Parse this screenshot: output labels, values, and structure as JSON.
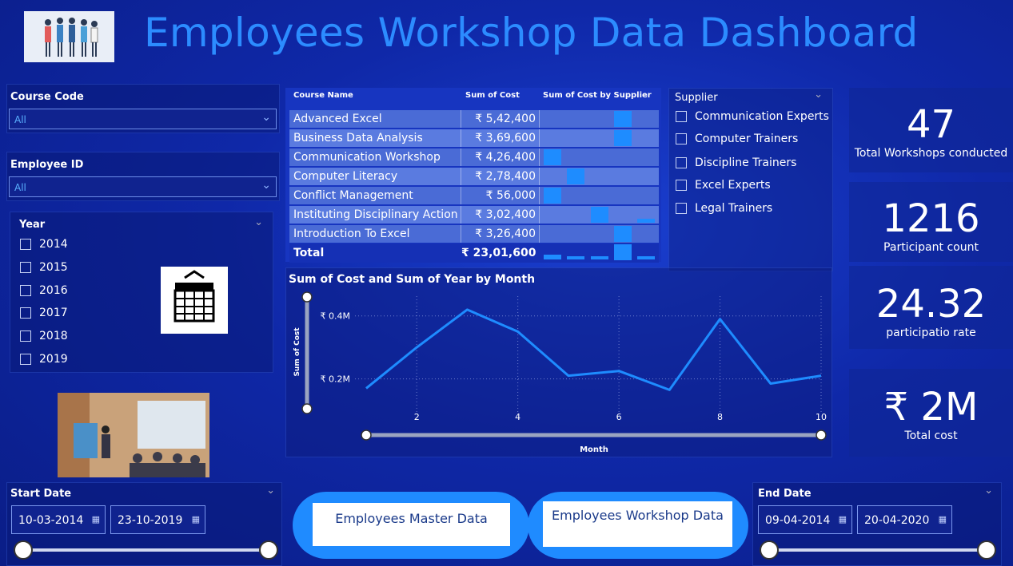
{
  "header": {
    "title": "Employees Workshop  Data Dashboard"
  },
  "filters": {
    "course_code": {
      "label": "Course Code",
      "value": "All"
    },
    "employee_id": {
      "label": "Employee ID",
      "value": "All"
    },
    "year": {
      "label": "Year",
      "options": [
        "2014",
        "2015",
        "2016",
        "2017",
        "2018",
        "2019"
      ]
    },
    "supplier": {
      "label": "Supplier",
      "options": [
        "Communication Experts",
        "Computer Trainers",
        "Discipline Trainers",
        "Excel Experts",
        "Legal Trainers"
      ]
    }
  },
  "table": {
    "headers": {
      "course": "Course Name",
      "cost": "Sum of Cost",
      "by_supplier": "Sum of Cost by Supplier"
    },
    "rows": [
      {
        "course": "Advanced Excel",
        "cost": "₹ 5,42,400"
      },
      {
        "course": "Business Data Analysis",
        "cost": "₹ 3,69,600"
      },
      {
        "course": "Communication Workshop",
        "cost": "₹ 4,26,400"
      },
      {
        "course": "Computer Literacy",
        "cost": "₹ 2,78,400"
      },
      {
        "course": "Conflict Management",
        "cost": "₹ 56,000"
      },
      {
        "course": "Instituting Disciplinary Action",
        "cost": "₹ 3,02,400"
      },
      {
        "course": "Introduction To Excel",
        "cost": "₹ 3,26,400"
      }
    ],
    "total": {
      "label": "Total",
      "cost": "₹ 23,01,600"
    }
  },
  "chart_data": {
    "type": "line",
    "title": "Sum of Cost and Sum of Year by Month",
    "xlabel": "Month",
    "ylabel": "Sum of Cost",
    "x_ticks": [
      "2",
      "4",
      "6",
      "8",
      "10"
    ],
    "y_ticks": [
      "₹ 0.2M",
      "₹ 0.4M"
    ],
    "xlim": [
      1,
      10
    ],
    "series": [
      {
        "values": [
          [
            1,
            0.17
          ],
          [
            2,
            0.3
          ],
          [
            3,
            0.42
          ],
          [
            4,
            0.35
          ],
          [
            5,
            0.21
          ],
          [
            6,
            0.225
          ],
          [
            7,
            0.165
          ],
          [
            8,
            0.39
          ],
          [
            9,
            0.185
          ],
          [
            10,
            0.21
          ]
        ]
      }
    ],
    "ylim": [
      0.1,
      0.45
    ],
    "color": "#1e8cff"
  },
  "kpis": [
    {
      "value": "47",
      "label": "Total Workshops conducted"
    },
    {
      "value": "1216",
      "label": "Participant count"
    },
    {
      "value": "24.32",
      "label": "participatio rate"
    },
    {
      "value": "₹ 2M",
      "label": "Total cost"
    }
  ],
  "start_date": {
    "label": "Start Date",
    "from": "10-03-2014",
    "to": "23-10-2019"
  },
  "end_date": {
    "label": "End Date",
    "from": "09-04-2014",
    "to": "20-04-2020"
  },
  "buttons": {
    "master": "Employees Master Data",
    "workshop": "Employees Workshop Data"
  },
  "colors": {
    "accent": "#1e8cff",
    "title": "#2c8cff"
  }
}
